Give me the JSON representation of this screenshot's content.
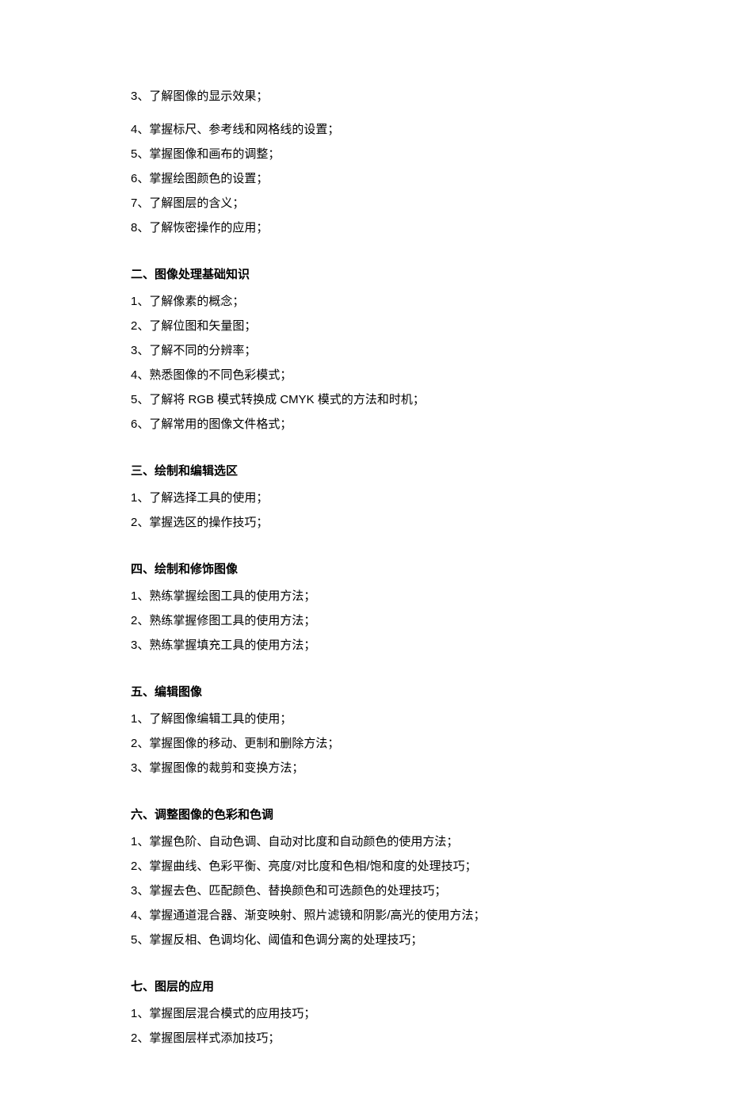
{
  "topItems": [
    "3、了解图像的显示效果；",
    "4、掌握标尺、参考线和网格线的设置；",
    "5、掌握图像和画布的调整；",
    "6、掌握绘图颜色的设置；",
    "7、了解图层的含义；",
    "8、了解恢密操作的应用；"
  ],
  "sections": [
    {
      "heading": "二、图像处理基础知识",
      "items": [
        "1、了解像素的概念；",
        "2、了解位图和矢量图；",
        "3、了解不同的分辨率；",
        "4、熟悉图像的不同色彩模式；",
        "5、了解将 RGB 模式转换成 CMYK 模式的方法和时机；",
        "6、了解常用的图像文件格式；"
      ]
    },
    {
      "heading": "三、绘制和编辑选区",
      "items": [
        "1、了解选择工具的使用；",
        "2、掌握选区的操作技巧；"
      ]
    },
    {
      "heading": "四、绘制和修饰图像",
      "items": [
        "1、熟练掌握绘图工具的使用方法；",
        "2、熟练掌握修图工具的使用方法；",
        "3、熟练掌握填充工具的使用方法；"
      ]
    },
    {
      "heading": "五、编辑图像",
      "items": [
        "1、了解图像编辑工具的使用；",
        "2、掌握图像的移动、更制和删除方法；",
        "3、掌握图像的裁剪和变换方法；"
      ]
    },
    {
      "heading": "六、调整图像的色彩和色调",
      "items": [
        "1、掌握色阶、自动色调、自动对比度和自动颜色的使用方法；",
        "2、掌握曲线、色彩平衡、亮度/对比度和色相/饱和度的处理技巧；",
        "3、掌握去色、匹配颜色、替换颜色和可选颜色的处理技巧；",
        "4、掌握通道混合器、渐变映射、照片滤镜和阴影/高光的使用方法；",
        "5、掌握反相、色调均化、阈值和色调分离的处理技巧；"
      ]
    },
    {
      "heading": "七、图层的应用",
      "items": [
        "1、掌握图层混合模式的应用技巧；",
        "2、掌握图层样式添加技巧；"
      ]
    }
  ]
}
